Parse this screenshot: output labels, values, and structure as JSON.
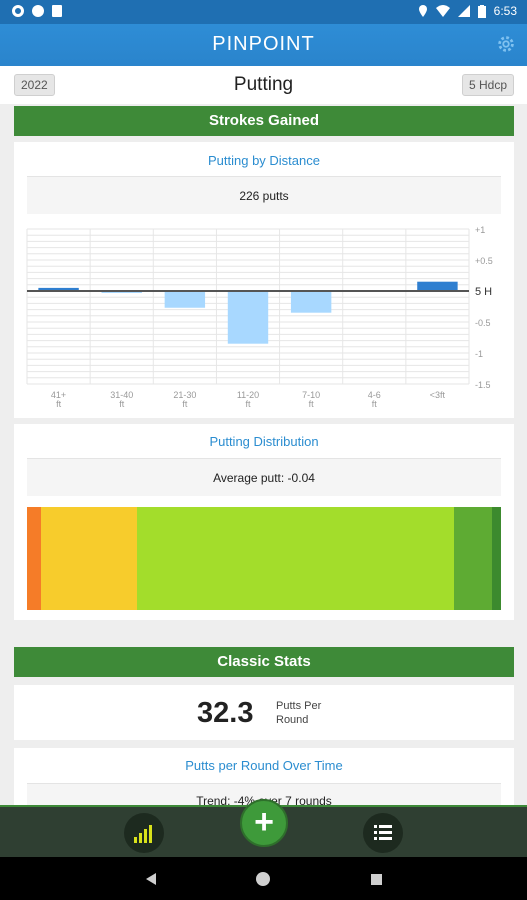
{
  "status_bar": {
    "time": "6:53"
  },
  "app": {
    "title": "PINPOINT"
  },
  "header": {
    "year": "2022",
    "title": "Putting",
    "handicap": "5 Hdcp"
  },
  "strokes_gained": {
    "section_title": "Strokes Gained",
    "distance_card": {
      "title": "Putting by Distance",
      "subtitle": "226 putts"
    },
    "distribution_card": {
      "title": "Putting Distribution",
      "subtitle": "Average putt: -0.04"
    }
  },
  "classic_stats": {
    "section_title": "Classic Stats",
    "putts_per_round": "32.3",
    "putts_per_round_label": "Putts Per Round",
    "over_time_card": {
      "title": "Putts per Round Over Time",
      "trend": "Trend: -4% over 7 rounds"
    }
  },
  "colors": {
    "app_bar": "#2a84cc",
    "section_green": "#3e8a38",
    "bar_positive": "#2f7fd0",
    "bar_negative": "#a8d8ff",
    "dist_orange": "#f57c28",
    "dist_yellow": "#f7cc2c",
    "dist_lime": "#a3dd2b",
    "dist_green": "#5eab33",
    "dist_dark_green": "#3c8a2e"
  },
  "distribution": [
    {
      "name": "orange",
      "fraction": 0.029
    },
    {
      "name": "yellow",
      "fraction": 0.203
    },
    {
      "name": "lime",
      "fraction": 0.669
    },
    {
      "name": "green",
      "fraction": 0.08
    },
    {
      "name": "dark-green",
      "fraction": 0.019
    }
  ],
  "chart_data": {
    "type": "bar",
    "categories": [
      "41+\nft",
      "31-40\nft",
      "21-30\nft",
      "11-20\nft",
      "7-10\nft",
      "4-6\nft",
      "<3ft"
    ],
    "values": [
      0.05,
      -0.03,
      -0.27,
      -0.85,
      -0.35,
      0.0,
      0.15
    ],
    "y_ticks": [
      "+1",
      "+0.5",
      "5 H",
      "-0.5",
      "-1",
      "-1.5"
    ],
    "y_tick_values": [
      1,
      0.5,
      0,
      -0.5,
      -1,
      -1.5
    ],
    "ylim": [
      -1.5,
      1.0
    ],
    "grid": true,
    "baseline_label": "5 H"
  },
  "nav": {
    "stats_icon": "bar-chart-icon",
    "add_label": "+",
    "list_icon": "list-icon"
  }
}
